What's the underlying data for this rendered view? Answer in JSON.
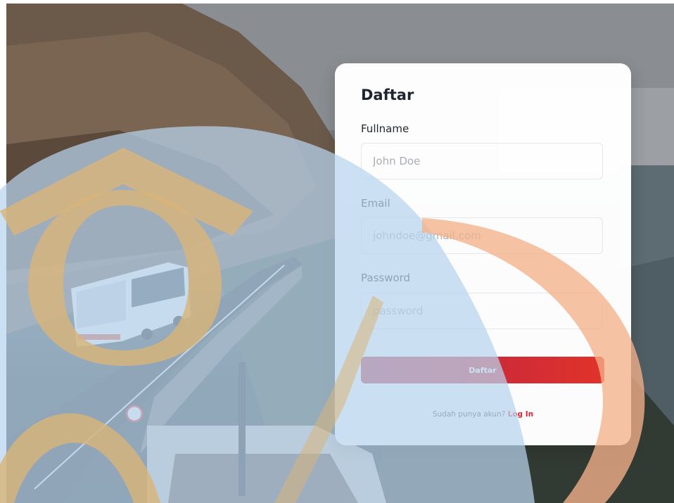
{
  "form": {
    "title": "Daftar",
    "fields": [
      {
        "label": "Fullname",
        "placeholder": "John Doe",
        "value": ""
      },
      {
        "label": "Email",
        "placeholder": "johndoe@gmail.com",
        "value": ""
      },
      {
        "label": "Password",
        "placeholder": "password",
        "value": ""
      }
    ],
    "submit_label": "Daftar",
    "footer_prompt": "Sudah punya akun?",
    "footer_link": "Log In"
  },
  "colors": {
    "button_start": "#b3364b",
    "button_end": "#e03329",
    "link": "#d4263a",
    "overlay_blue": "#b9d4ee",
    "overlay_orange": "#f3b18a",
    "overlay_tan": "#d8b47a"
  },
  "icons": {
    "background_photo": "coastal-mountain-road-with-bus",
    "overlay_logo": "graduation-cap-bus-logo"
  }
}
